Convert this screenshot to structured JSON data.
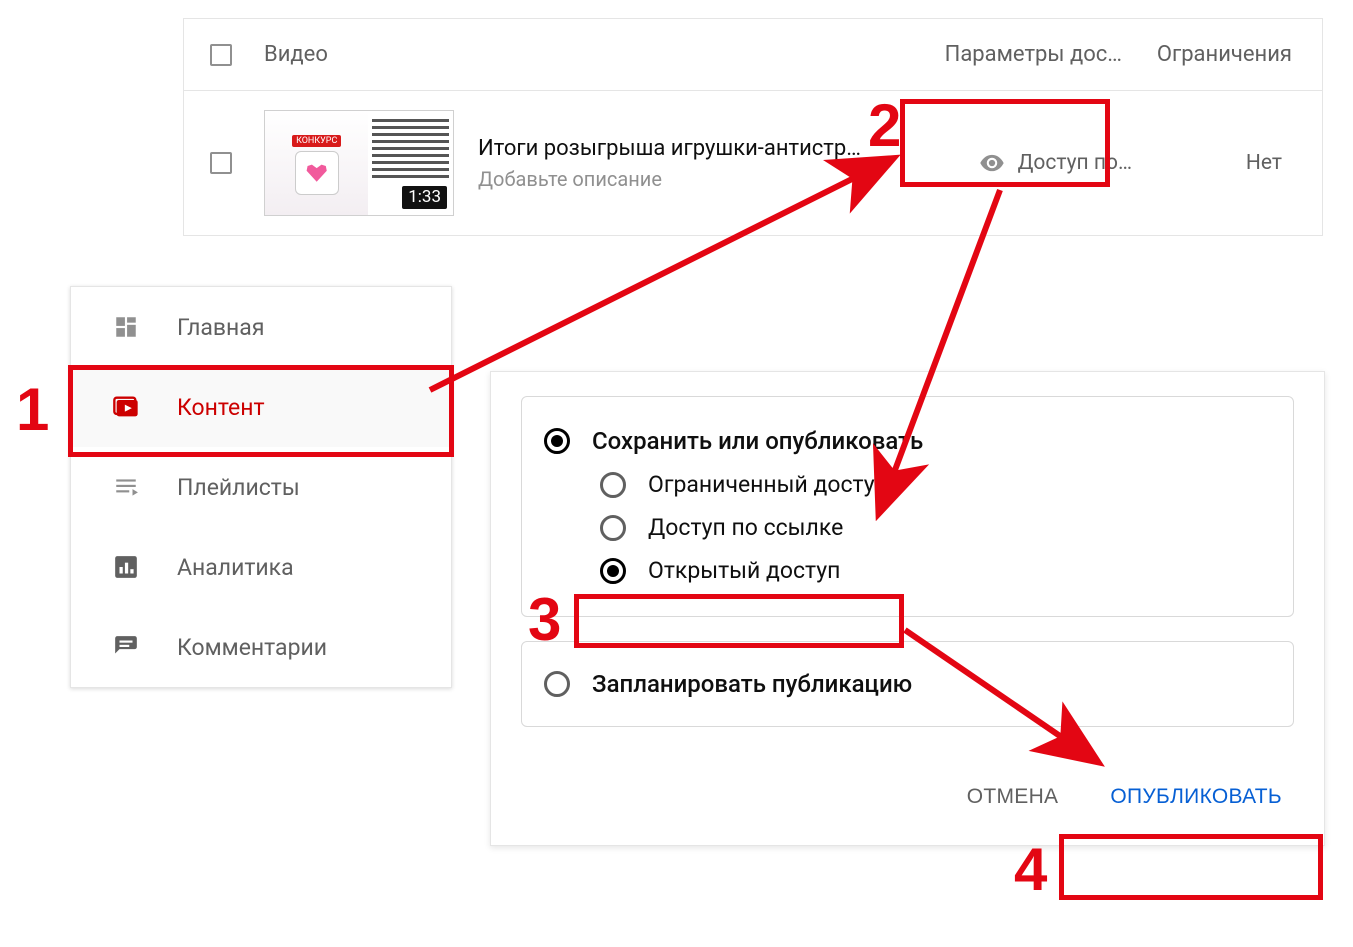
{
  "table": {
    "header_video": "Видео",
    "header_visibility": "Параметры дос…",
    "header_restrictions": "Ограничения",
    "row": {
      "title": "Итоги розыгрыша игрушки-антистр…",
      "subtitle": "Добавьте описание",
      "duration": "1:33",
      "visibility": "Доступ по…",
      "restrictions": "Нет"
    }
  },
  "sidebar": {
    "items": [
      {
        "label": "Главная"
      },
      {
        "label": "Контент"
      },
      {
        "label": "Плейлисты"
      },
      {
        "label": "Аналитика"
      },
      {
        "label": "Комментарии"
      }
    ]
  },
  "publish": {
    "save_or_publish": "Сохранить или опубликовать",
    "private": "Ограниченный доступ",
    "unlisted": "Доступ по ссылке",
    "public": "Открытый доступ",
    "schedule": "Запланировать публикацию",
    "cancel": "ОТМЕНА",
    "publish_btn": "ОПУБЛИКОВАТЬ"
  },
  "annotations": {
    "step1": "1",
    "step2": "2",
    "step3": "3",
    "step4": "4"
  }
}
